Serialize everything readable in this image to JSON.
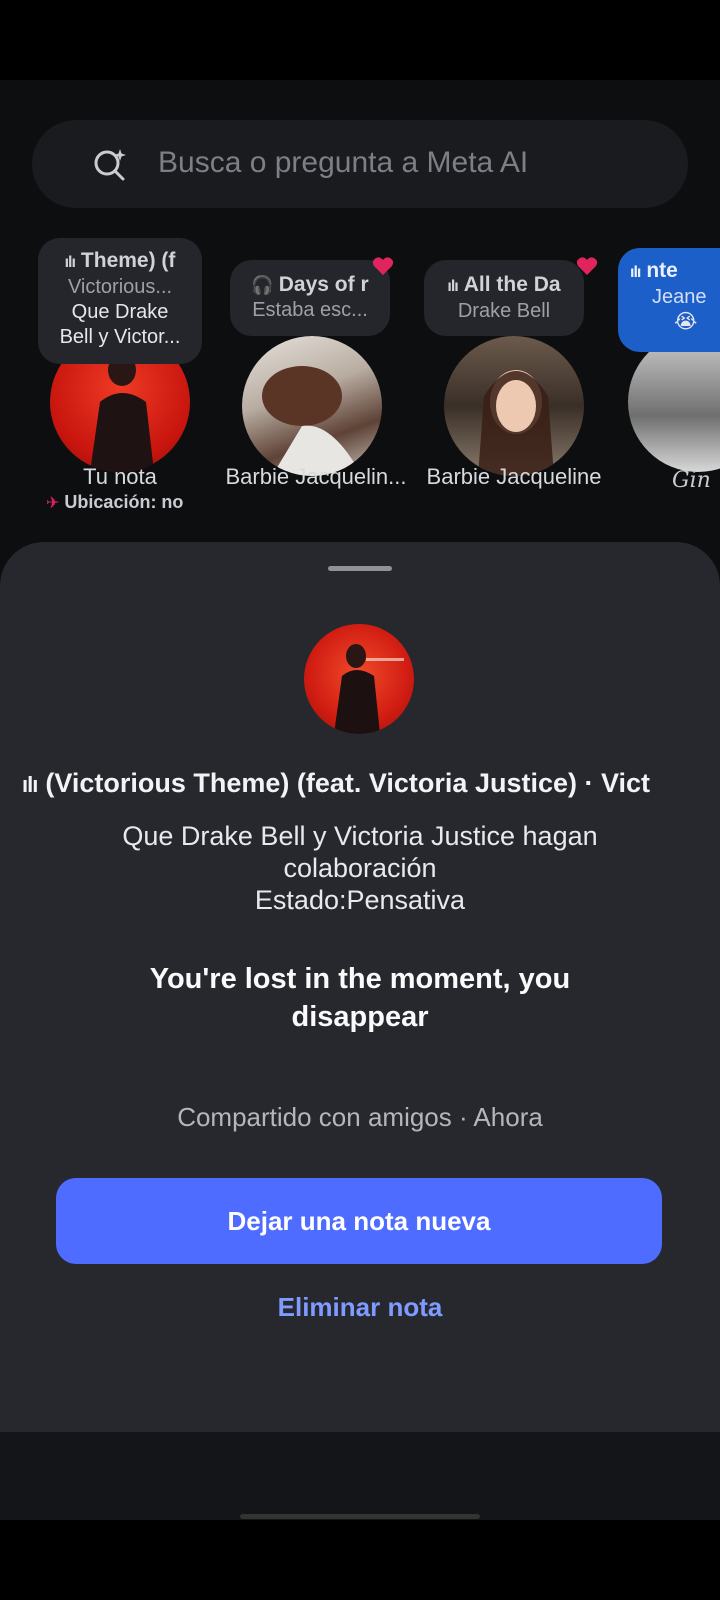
{
  "search": {
    "placeholder": "Busca o pregunta a Meta AI"
  },
  "notes": [
    {
      "bubble_title": "Theme) (f",
      "bubble_sub": "Victorious...",
      "bubble_line1": "Que Drake",
      "bubble_line2": "Bell y Victor...",
      "name": "Tu nota",
      "subtext": "Ubicación: no"
    },
    {
      "bubble_title": "Days of r",
      "bubble_sub": "Estaba esc...",
      "name": "Barbie Jacquelin...",
      "liked": true
    },
    {
      "bubble_title": "All the Da",
      "bubble_sub": "Drake Bell",
      "name": "Barbie Jacqueline",
      "liked": true
    },
    {
      "bubble_title": "nte",
      "bubble_sub": "Jeane",
      "name": "Gin"
    }
  ],
  "sheet": {
    "music_line": "(Victorious Theme) (feat. Victoria Justice) · Vict",
    "note_lines": [
      "Que Drake Bell y Victoria Justice hagan",
      "colaboración",
      "Estado:Pensativa"
    ],
    "lyrics": "You're lost in the moment, you disappear",
    "shared": "Compartido con amigos · Ahora",
    "primary_button": "Dejar una nota nueva",
    "delete_link": "Eliminar nota"
  },
  "colors": {
    "accent": "#4e6cff",
    "link": "#7f9bff",
    "heart": "#e0245e",
    "blue_bubble": "#1d5fc9"
  }
}
